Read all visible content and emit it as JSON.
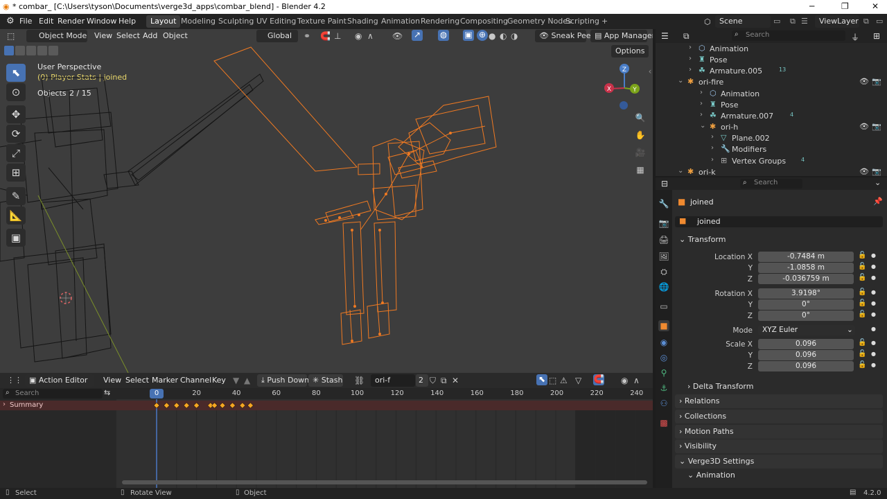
{
  "window": {
    "title": "* combar_ [C:\\Users\\tyson\\Documents\\verge3d_apps\\combar_blend] - Blender 4.2",
    "controls": [
      "─",
      "❐",
      "✕"
    ]
  },
  "menu": [
    "File",
    "Edit",
    "Render",
    "Window",
    "Help"
  ],
  "workspaces": [
    "Layout",
    "Modeling",
    "Sculpting",
    "UV Editing",
    "Texture Paint",
    "Shading",
    "Animation",
    "Rendering",
    "Compositing",
    "Geometry Nodes",
    "Scripting"
  ],
  "workspace_add": "+",
  "scene": {
    "name": "Scene",
    "view_layer": "ViewLayer"
  },
  "viewport": {
    "mode": "Object Mode",
    "menus": [
      "View",
      "Select",
      "Add",
      "Object"
    ],
    "orientation": "Global",
    "sneak_peek": "Sneak Peek",
    "app_manager": "App Manager",
    "options": "Options",
    "overlay_title": "User Perspective",
    "overlay_object": "(0) Player Stats | joined",
    "objects_label": "Objects",
    "objects_count": "2 / 15",
    "gizmo": {
      "z": "Z",
      "x": "X",
      "y": "Y"
    }
  },
  "action_editor": {
    "editor": "Action Editor",
    "menus": [
      "View",
      "Select",
      "Marker",
      "Channel",
      "Key"
    ],
    "push_down": "Push Down",
    "stash": "Stash",
    "action_name": "ori-f",
    "users": "2",
    "search_placeholder": "Search",
    "summary": "Summary",
    "ruler": [
      "0",
      "20",
      "40",
      "60",
      "80",
      "100",
      "120",
      "140",
      "160",
      "180",
      "200",
      "220",
      "240"
    ],
    "current_frame": "0",
    "keyframes": [
      0,
      5,
      10,
      15,
      20,
      27,
      29,
      33,
      38,
      43,
      47
    ]
  },
  "outliner": {
    "search_placeholder": "Search",
    "rows": [
      {
        "label": "Animation",
        "indent": 1
      },
      {
        "label": "Pose",
        "indent": 1
      },
      {
        "label": "Armature.005",
        "indent": 1,
        "badge": "13"
      },
      {
        "label": "ori-fire",
        "indent": 0
      },
      {
        "label": "Animation",
        "indent": 2
      },
      {
        "label": "Pose",
        "indent": 2
      },
      {
        "label": "Armature.007",
        "indent": 2,
        "badge": "4"
      },
      {
        "label": "ori-h",
        "indent": 2
      },
      {
        "label": "Plane.002",
        "indent": 3
      },
      {
        "label": "Modifiers",
        "indent": 3
      },
      {
        "label": "Vertex Groups",
        "indent": 3,
        "badge": "4"
      },
      {
        "label": "ori-k",
        "indent": 0
      }
    ]
  },
  "properties": {
    "search_placeholder": "Search",
    "object_name": "joined",
    "datablock_name": "joined",
    "transform": "Transform",
    "location_label": "Location X",
    "location": [
      "-0.7484 m",
      "-1.0858 m",
      "-0.036759 m"
    ],
    "rotation_label": "Rotation X",
    "rotation": [
      "3.9198°",
      "0°",
      "0°"
    ],
    "mode_label": "Mode",
    "mode": "XYZ Euler",
    "scale_label": "Scale X",
    "scale": [
      "0.096",
      "0.096",
      "0.096"
    ],
    "axis_y": "Y",
    "axis_z": "Z",
    "sections": [
      "Delta Transform",
      "Relations",
      "Collections",
      "Motion Paths",
      "Visibility",
      "Verge3D Settings",
      "Animation"
    ]
  },
  "statusbar": {
    "select": "Select",
    "rotate_view": "Rotate View",
    "object": "Object",
    "version": "4.2.0"
  },
  "colors": {
    "accent": "#4772b3",
    "selection": "#f07a22",
    "keyframe": "#f5a623"
  }
}
